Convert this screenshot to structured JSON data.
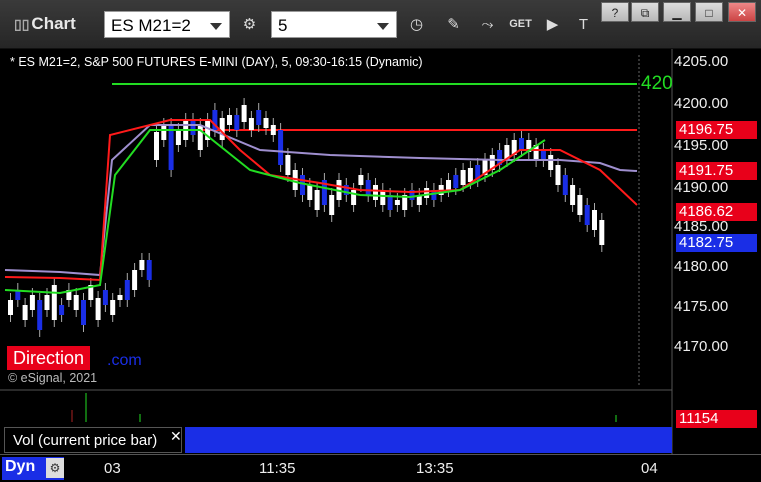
{
  "toolbar": {
    "app_title": "Chart",
    "symbol": "ES M21=2",
    "interval": "5"
  },
  "chart": {
    "header": "* ES M21=2, S&P 500 FUTURES E-MINI (DAY), 5, 09:30-16:15 (Dynamic)",
    "watermark": "© eSignal, 2021",
    "direction_label": "Direction",
    "link_fragment": ".com",
    "price_axis": [
      "4205.00",
      "4200.00",
      "4195.00",
      "4190.00",
      "4185.00",
      "4180.00",
      "4175.00",
      "4170.00"
    ],
    "green_line_label": "420",
    "tags": {
      "red_high": "4196.75",
      "red_mid": "4191.75",
      "red_low": "4186.62",
      "last_price": "4182.75",
      "volume": "11154"
    },
    "volume_pane_label": "Vol (current price bar)",
    "time_axis": [
      "03",
      "11:35",
      "13:35",
      "04"
    ],
    "footer_label": "Dyn",
    "colors": {
      "bull_candle": "#ffffff",
      "bear_candle": "#1a2ee6",
      "red_line": "#ff1a1a",
      "green_line": "#22dd22",
      "purple_line": "#9f8fcf",
      "tag_red": "#e8001a",
      "tag_blue": "#1a2ee6"
    }
  }
}
